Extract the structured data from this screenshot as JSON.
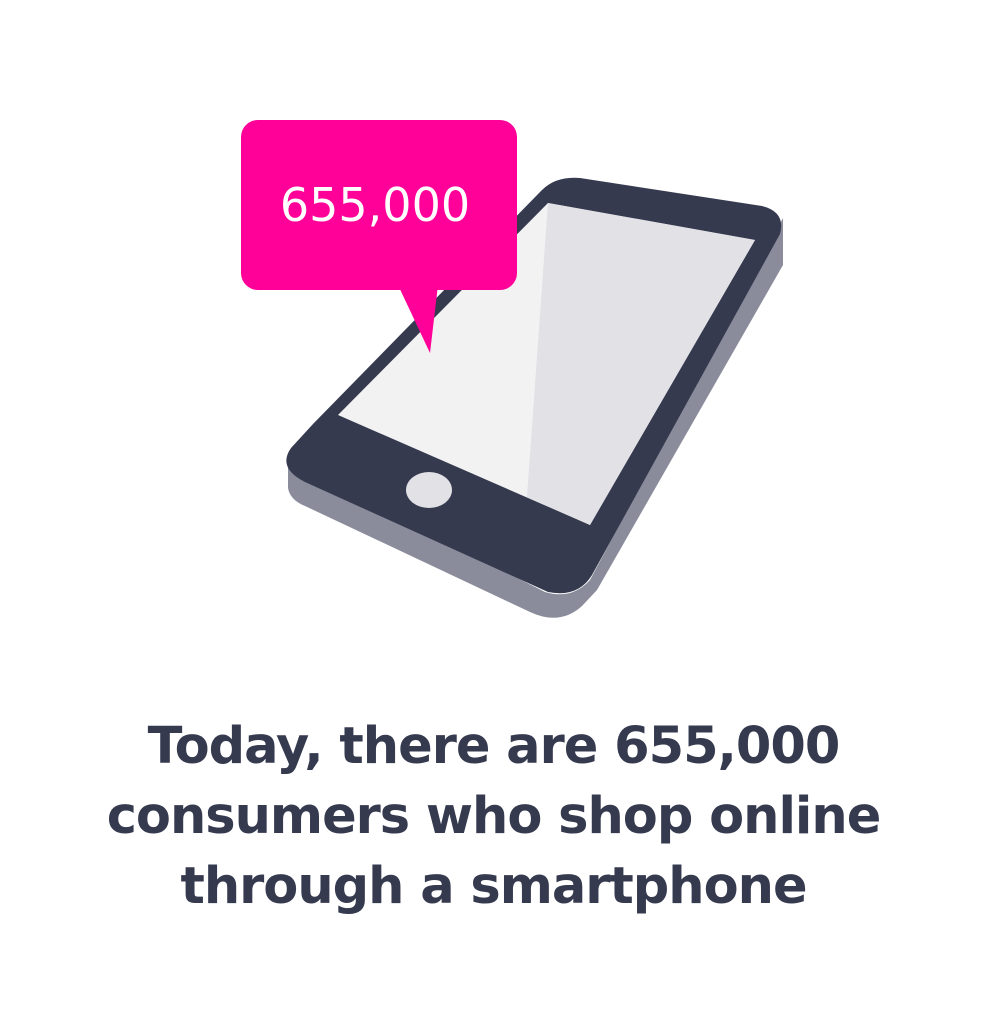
{
  "bubble": {
    "value": "655,000"
  },
  "caption": {
    "lines": [
      "Today, there are 655,000",
      "consumers who shop online",
      "through a smartphone"
    ]
  },
  "colors": {
    "accent": "#ff0099",
    "phone_body": "#363a4f",
    "phone_side": "#8a8c9b",
    "screen_light": "#f2f2f3",
    "screen_shade": "#e1e1e6",
    "home_button": "#e1e1e6",
    "caption_text": "#363a4f"
  },
  "icons": [
    "smartphone-icon",
    "speech-bubble-icon"
  ]
}
